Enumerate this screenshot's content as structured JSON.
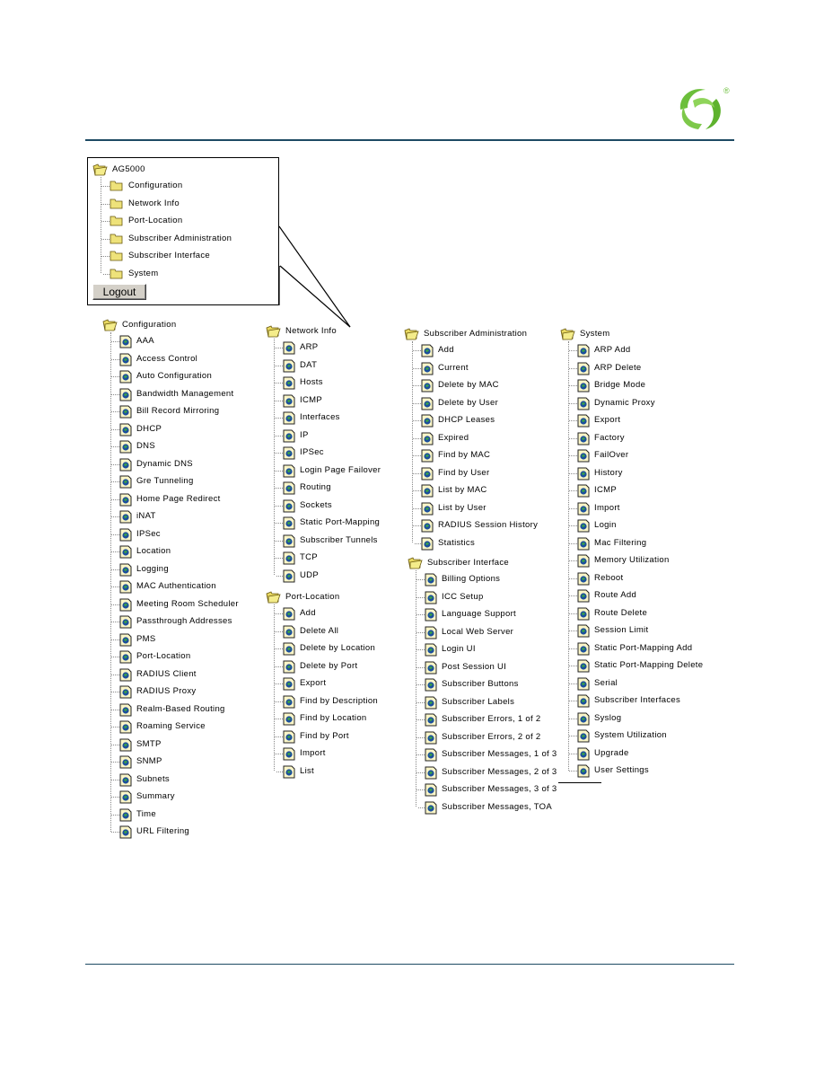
{
  "brand": {
    "logo_icon": "swirl-logo-icon",
    "registered_mark": "®",
    "accent_color": "#6cbf3b",
    "rule_color": "#1d4a63"
  },
  "callout": {
    "root_label": "AG5000",
    "items": [
      {
        "label": "Configuration"
      },
      {
        "label": "Network Info"
      },
      {
        "label": "Port-Location"
      },
      {
        "label": "Subscriber Administration"
      },
      {
        "label": "Subscriber Interface"
      },
      {
        "label": "System"
      }
    ],
    "logout_label": "Logout"
  },
  "trees": {
    "configuration": {
      "label": "Configuration",
      "items": [
        "AAA",
        "Access Control",
        "Auto Configuration",
        "Bandwidth Management",
        "Bill Record Mirroring",
        "DHCP",
        "DNS",
        "Dynamic DNS",
        "Gre Tunneling",
        "Home Page Redirect",
        "iNAT",
        "IPSec",
        "Location",
        "Logging",
        "MAC Authentication",
        "Meeting Room Scheduler",
        "Passthrough Addresses",
        "PMS",
        "Port-Location",
        "RADIUS Client",
        "RADIUS Proxy",
        "Realm-Based Routing",
        "Roaming Service",
        "SMTP",
        "SNMP",
        "Subnets",
        "Summary",
        "Time",
        "URL Filtering"
      ]
    },
    "network_info": {
      "label": "Network Info",
      "items": [
        "ARP",
        "DAT",
        "Hosts",
        "ICMP",
        "Interfaces",
        "IP",
        "IPSec",
        "Login Page Failover",
        "Routing",
        "Sockets",
        "Static Port-Mapping",
        "Subscriber Tunnels",
        "TCP",
        "UDP"
      ]
    },
    "port_location": {
      "label": "Port-Location",
      "items": [
        "Add",
        "Delete All",
        "Delete by Location",
        "Delete by Port",
        "Export",
        "Find by Description",
        "Find by Location",
        "Find by Port",
        "Import",
        "List"
      ]
    },
    "subscriber_administration": {
      "label": "Subscriber Administration",
      "items": [
        "Add",
        "Current",
        "Delete by MAC",
        "Delete by User",
        "DHCP Leases",
        "Expired",
        "Find by MAC",
        "Find by User",
        "List by MAC",
        "List by User",
        "RADIUS Session History",
        "Statistics"
      ]
    },
    "subscriber_interface": {
      "label": "Subscriber Interface",
      "items": [
        "Billing Options",
        "ICC Setup",
        "Language Support",
        "Local Web Server",
        "Login UI",
        "Post Session UI",
        "Subscriber Buttons",
        "Subscriber Labels",
        "Subscriber Errors, 1 of 2",
        "Subscriber Errors, 2 of 2",
        "Subscriber Messages, 1 of 3",
        "Subscriber Messages, 2 of 3",
        "Subscriber Messages, 3 of 3",
        "Subscriber Messages, TOA"
      ]
    },
    "system": {
      "label": "System",
      "items": [
        "ARP Add",
        "ARP Delete",
        "Bridge Mode",
        "Dynamic Proxy",
        "Export",
        "Factory",
        "FailOver",
        "History",
        "ICMP",
        "Import",
        "Login",
        "Mac Filtering",
        "Memory Utilization",
        "Reboot",
        "Route Add",
        "Route Delete",
        "Session Limit",
        "Static Port-Mapping Add",
        "Static Port-Mapping Delete",
        "Serial",
        "Subscriber Interfaces",
        "Syslog",
        "System Utilization",
        "Upgrade",
        "User Settings"
      ]
    }
  }
}
